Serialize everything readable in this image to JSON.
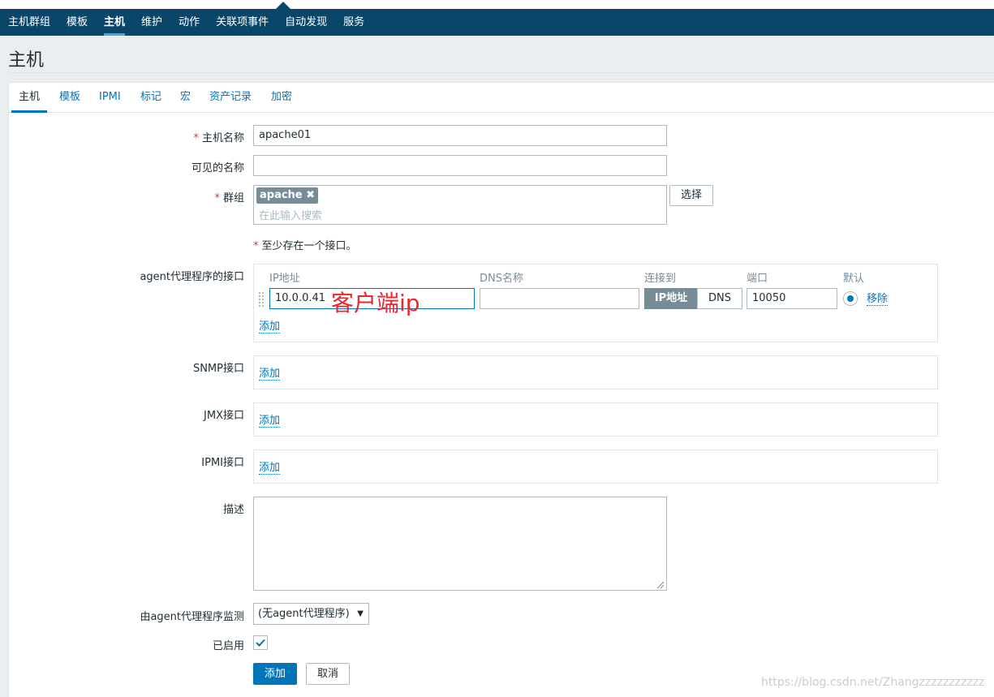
{
  "nav": {
    "items": [
      "主机群组",
      "模板",
      "主机",
      "维护",
      "动作",
      "关联项事件",
      "自动发现",
      "服务"
    ],
    "active_index": 2
  },
  "page": {
    "title": "主机"
  },
  "tabs": [
    "主机",
    "模板",
    "IPMI",
    "标记",
    "宏",
    "资产记录",
    "加密"
  ],
  "form": {
    "host_name_label": "主机名称",
    "host_name_value": "apache01",
    "visible_name_label": "可见的名称",
    "visible_name_value": "",
    "groups_label": "群组",
    "group_tag": "apache",
    "group_search_placeholder": "在此输入搜索",
    "select_button": "选择",
    "interface_note": "至少存在一个接口。",
    "agent_interfaces_label": "agent代理程序的接口",
    "columns": {
      "ip": "IP地址",
      "dns": "DNS名称",
      "connect": "连接到",
      "port": "端口",
      "default": "默认"
    },
    "agent_row": {
      "ip": "10.0.0.41",
      "dns": "",
      "connect_ip": "IP地址",
      "connect_dns": "DNS",
      "port": "10050",
      "remove": "移除"
    },
    "add_link": "添加",
    "snmp_label": "SNMP接口",
    "jmx_label": "JMX接口",
    "ipmi_label": "IPMI接口",
    "description_label": "描述",
    "description_value": "",
    "proxy_label": "由agent代理程序监测",
    "proxy_value": "(无agent代理程序)",
    "enabled_label": "已启用",
    "enabled": true,
    "add_button": "添加",
    "cancel_button": "取消"
  },
  "annotation": {
    "text": "客户端ip"
  },
  "watermark": {
    "text": "https://blog.csdn.net/Zhangzzzzzzzzzzz"
  },
  "colors": {
    "nav_bg": "#0a466a",
    "link": "#0275b8",
    "primary_button": "#0275b8",
    "annotation": "#e8262d"
  }
}
